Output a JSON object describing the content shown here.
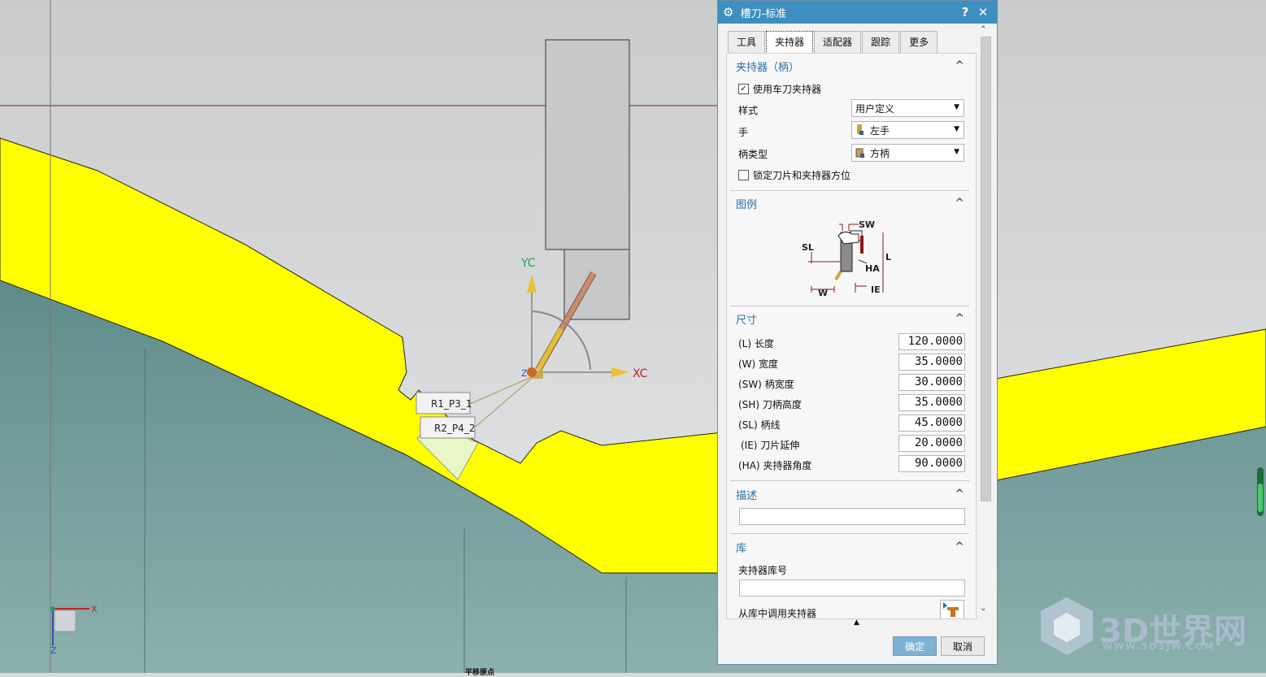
{
  "viewport": {
    "axis_yc": "YC",
    "axis_xc": "XC",
    "axis_zc": "Z",
    "tag1": "R1_P3_1",
    "tag2": "R2_P4_2",
    "triad_x": "X",
    "triad_z": "Z",
    "bottom_label": "平移原点"
  },
  "dialog": {
    "title": "槽刀-标准",
    "help": "?",
    "close": "✕",
    "tabs": [
      "工具",
      "夹持器",
      "适配器",
      "跟踪",
      "更多"
    ],
    "active_tab": "夹持器",
    "holder_section": {
      "title": "夹持器（柄）",
      "use_holder_label": "使用车刀夹持器",
      "use_holder_checked": true,
      "style_label": "样式",
      "style_value": "用户定义",
      "hand_label": "手",
      "hand_value": "左手",
      "shank_type_label": "柄类型",
      "shank_type_value": "方柄",
      "lock_label": "锁定刀片和夹持器方位",
      "lock_checked": false
    },
    "legend_section": {
      "title": "图例",
      "labels": [
        "SW",
        "SL",
        "L",
        "HA",
        "W",
        "IE"
      ]
    },
    "dimensions_section": {
      "title": "尺寸",
      "rows": [
        {
          "label": "(L) 长度",
          "value": "120.0000"
        },
        {
          "label": "(W) 宽度",
          "value": "35.0000"
        },
        {
          "label": "(SW) 柄宽度",
          "value": "30.0000"
        },
        {
          "label": "(SH) 刀柄高度",
          "value": "35.0000"
        },
        {
          "label": "(SL) 柄线",
          "value": "45.0000"
        },
        {
          "label": "(IE) 刀片延伸",
          "value": "20.0000"
        },
        {
          "label": "(HA) 夹持器角度",
          "value": "90.0000"
        }
      ]
    },
    "description_section": {
      "title": "描述",
      "value": ""
    },
    "library_section": {
      "title": "库",
      "lib_number_label": "夹持器库号",
      "lib_number_value": "",
      "call_from_lib_label": "从库中调用夹持器"
    },
    "ok_label": "确定",
    "cancel_label": "取消"
  },
  "watermark": {
    "big": "3D世界网",
    "small": "WWW.3DSJW.COM"
  },
  "colors": {
    "accent": "#3c8fbf",
    "part_yellow": "#ffff00",
    "teal_body": "#6d9a98"
  }
}
